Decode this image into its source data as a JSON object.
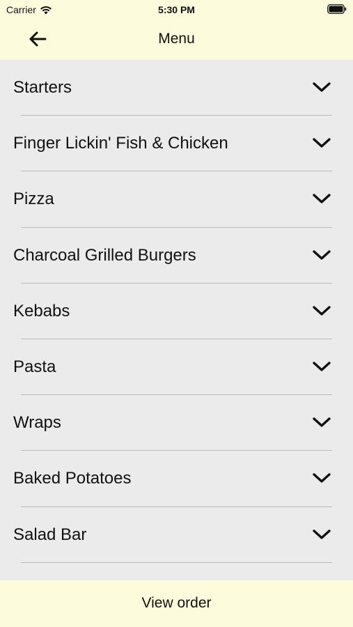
{
  "status_bar": {
    "carrier": "Carrier",
    "time": "5:30 PM",
    "wifi_icon": "wifi-icon",
    "battery_icon": "battery-icon"
  },
  "header": {
    "title": "Menu",
    "back_icon": "arrow-left-icon",
    "background_color": "#fcfbdb"
  },
  "menu": {
    "background_color": "#ebebeb",
    "chevron_icon": "chevron-down-icon",
    "categories": [
      {
        "label": "Starters"
      },
      {
        "label": "Finger Lickin' Fish & Chicken"
      },
      {
        "label": "Pizza"
      },
      {
        "label": "Charcoal Grilled Burgers"
      },
      {
        "label": "Kebabs"
      },
      {
        "label": "Pasta"
      },
      {
        "label": "Wraps"
      },
      {
        "label": "Baked Potatoes"
      },
      {
        "label": "Salad Bar"
      }
    ]
  },
  "footer": {
    "view_order_label": "View order"
  }
}
